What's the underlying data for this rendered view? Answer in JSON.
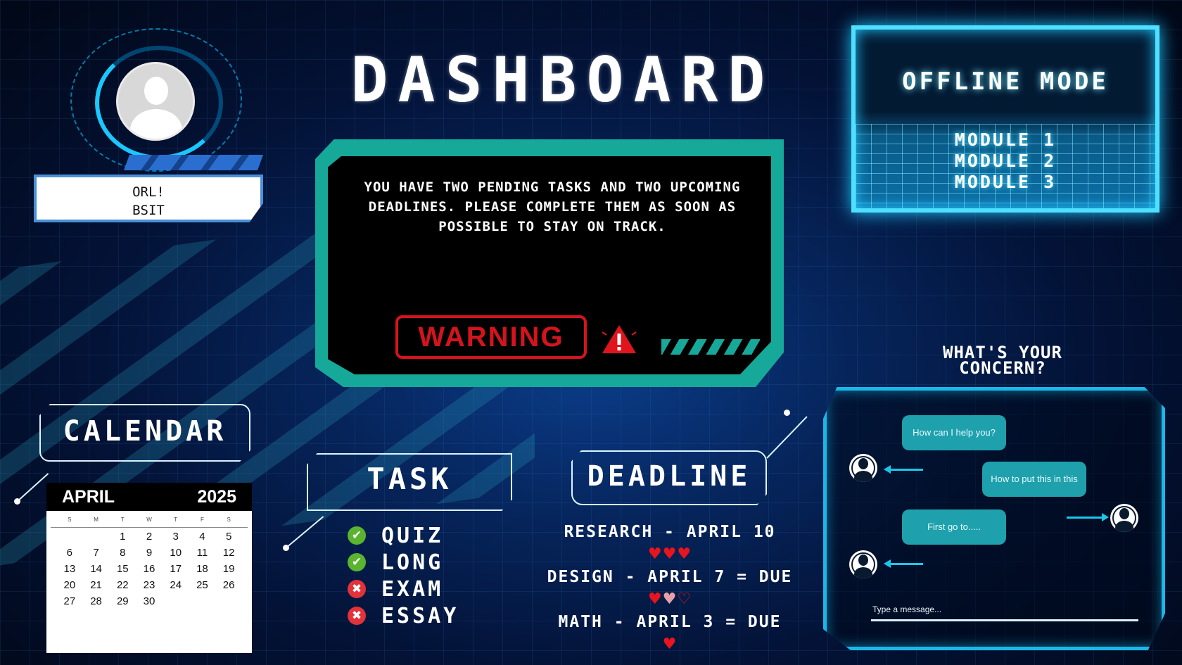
{
  "header": {
    "title": "DASHBOARD"
  },
  "profile": {
    "name": "ORL!",
    "program": "BSIT"
  },
  "notice": {
    "message": "YOU HAVE TWO PENDING TASKS AND TWO UPCOMING DEADLINES. PLEASE COMPLETE THEM AS SOON AS POSSIBLE TO STAY ON TRACK.",
    "badge": "WARNING",
    "icon": "warning-icon",
    "accent_color": "#16a99a",
    "badge_color": "#d4141c"
  },
  "offline": {
    "title": "OFFLINE MODE",
    "modules": [
      "MODULE 1",
      "MODULE 2",
      "MODULE 3"
    ]
  },
  "calendar": {
    "title": "CALENDAR",
    "month": "APRIL",
    "year": "2025",
    "weekdays": [
      "S",
      "M",
      "T",
      "W",
      "T",
      "F",
      "S"
    ],
    "days": [
      "",
      "",
      "1",
      "2",
      "3",
      "4",
      "5",
      "6",
      "7",
      "8",
      "9",
      "10",
      "11",
      "12",
      "13",
      "14",
      "15",
      "16",
      "17",
      "18",
      "19",
      "20",
      "21",
      "22",
      "23",
      "24",
      "25",
      "26",
      "27",
      "28",
      "29",
      "30",
      "",
      "",
      ""
    ]
  },
  "tasks": {
    "title": "TASK",
    "items": [
      {
        "label": "QUIZ",
        "done": true,
        "icon": "check-icon"
      },
      {
        "label": "LONG",
        "done": true,
        "icon": "check-icon"
      },
      {
        "label": "EXAM",
        "done": false,
        "icon": "x-icon"
      },
      {
        "label": "ESSAY",
        "done": false,
        "icon": "x-icon"
      }
    ]
  },
  "deadlines": {
    "title": "DEADLINE",
    "items": [
      {
        "text": "RESEARCH - APRIL 10",
        "hearts_full": 3,
        "hearts_total": 3
      },
      {
        "text": "DESIGN - APRIL 7 = DUE",
        "hearts_full": 1.5,
        "hearts_total": 3
      },
      {
        "text": "MATH - APRIL 3 = DUE",
        "hearts_full": 1,
        "hearts_total": 1
      }
    ]
  },
  "chat": {
    "prompt": "WHAT'S YOUR CONCERN?",
    "messages": [
      {
        "from": "bot",
        "text": "How can I help you?"
      },
      {
        "from": "user",
        "text": "How to put this in this"
      },
      {
        "from": "bot",
        "text": "First go to....."
      }
    ],
    "input_placeholder": "Type a message..."
  }
}
